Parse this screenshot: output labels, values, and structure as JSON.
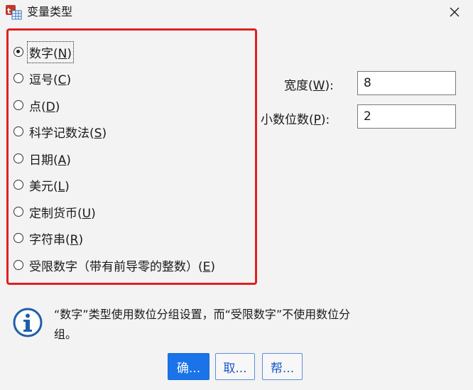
{
  "window": {
    "title": "变量类型",
    "icon": "spss-data-icon",
    "close_icon": "close-icon"
  },
  "variable_types": [
    {
      "text": "数字(",
      "key": "N",
      "end": ")",
      "checked": true
    },
    {
      "text": "逗号(",
      "key": "C",
      "end": ")",
      "checked": false
    },
    {
      "text": "点(",
      "key": "D",
      "end": ")",
      "checked": false
    },
    {
      "text": "科学记数法(",
      "key": "S",
      "end": ")",
      "checked": false
    },
    {
      "text": "日期(",
      "key": "A",
      "end": ")",
      "checked": false
    },
    {
      "text": "美元(",
      "key": "L",
      "end": ")",
      "checked": false
    },
    {
      "text": "定制货币(",
      "key": "U",
      "end": ")",
      "checked": false
    },
    {
      "text": "字符串(",
      "key": "R",
      "end": ")",
      "checked": false
    },
    {
      "text": "受限数字（带有前导零的整数）(",
      "key": "E",
      "end": ")",
      "checked": false
    }
  ],
  "width_field": {
    "label_pre": "宽度(",
    "key": "W",
    "label_post": "):",
    "value": "8"
  },
  "decimals_field": {
    "label_pre": "小数位数(",
    "key": "P",
    "label_post": "):",
    "value": "2"
  },
  "info": {
    "icon": "info-icon",
    "line1": "“数字”类型使用数位分组设置，而“受限数字”不使用数位分",
    "line2": "组。"
  },
  "buttons": {
    "ok": "确...",
    "cancel": "取...",
    "help": "帮..."
  },
  "colors": {
    "highlight_border": "#e02020",
    "primary_button": "#1a73e8",
    "info_icon": "#1f5fa8"
  }
}
